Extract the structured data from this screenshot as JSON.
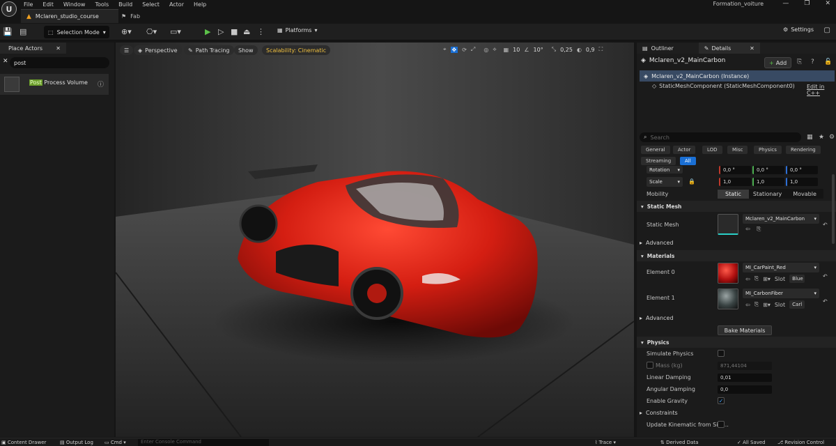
{
  "menu": [
    "File",
    "Edit",
    "Window",
    "Tools",
    "Build",
    "Select",
    "Actor",
    "Help"
  ],
  "tabs": {
    "project": "Mclaren_studio_course",
    "fab": "Fab"
  },
  "project_name": "Formation_voiture",
  "toolbar": {
    "selection_mode": "Selection Mode",
    "platforms": "Platforms",
    "settings": "Settings"
  },
  "left_panel": {
    "tab": "Place Actors",
    "search_value": "post",
    "item": {
      "highlight": "Post",
      "rest": " Process Volume"
    }
  },
  "viewport": {
    "perspective": "Perspective",
    "path_tracing": "Path Tracing",
    "show": "Show",
    "scalability": "Scalability: Cinematic",
    "grid": "10",
    "angle": "10°",
    "scale": "0,25",
    "camera": "0,9"
  },
  "right_panel": {
    "outliner_tab": "Outliner",
    "details_tab": "Details",
    "object_name": "Mclaren_v2_MainCarbon",
    "add_label": "Add",
    "instance_label": "Mclaren_v2_MainCarbon (Instance)",
    "component_label": "StaticMeshComponent (StaticMeshComponent0)",
    "edit_cpp": "Edit in C++",
    "search_placeholder": "Search",
    "filters": [
      "General",
      "Actor",
      "LOD",
      "Misc",
      "Physics",
      "Rendering",
      "Streaming",
      "All"
    ],
    "transform": {
      "rotation_label": "Rotation",
      "rotation": [
        "0,0 °",
        "0,0 °",
        "0,0 °"
      ],
      "scale_label": "Scale",
      "scale": [
        "1,0",
        "1,0",
        "1,0"
      ],
      "mobility_label": "Mobility",
      "mobility": [
        "Static",
        "Stationary",
        "Movable"
      ]
    },
    "static_mesh_section": "Static Mesh",
    "static_mesh_label": "Static Mesh",
    "static_mesh_value": "Mclaren_v2_MainCarbon",
    "advanced": "Advanced",
    "materials_section": "Materials",
    "element0": {
      "label": "Element 0",
      "value": "MI_CarPaint_Red",
      "slot": "Slot",
      "slot_name": "Blue"
    },
    "element1": {
      "label": "Element 1",
      "value": "MI_CarbonFiber",
      "slot": "Slot",
      "slot_name": "Carl"
    },
    "bake_materials": "Bake Materials",
    "physics_section": "Physics",
    "simulate_physics": "Simulate Physics",
    "mass_label": "Mass (kg)",
    "mass_value": "871,44104",
    "linear_damping_label": "Linear Damping",
    "linear_damping": "0,01",
    "angular_damping_label": "Angular Damping",
    "angular_damping": "0,0",
    "enable_gravity": "Enable Gravity",
    "constraints": "Constraints",
    "update_kinematic": "Update Kinematic from Sim..."
  },
  "bottom_bar": {
    "content_drawer": "Content Drawer",
    "output_log": "Output Log",
    "cmd": "Cmd",
    "console_placeholder": "Enter Console Command",
    "trace": "Trace",
    "derived_data": "Derived Data",
    "all_saved": "All Saved",
    "revision_control": "Revision Control"
  },
  "colors": {
    "accent_blue": "#1a6fd4",
    "play_green": "#5cc24a",
    "car_red": "#c81d14",
    "scalability_yellow": "#f0c040"
  }
}
